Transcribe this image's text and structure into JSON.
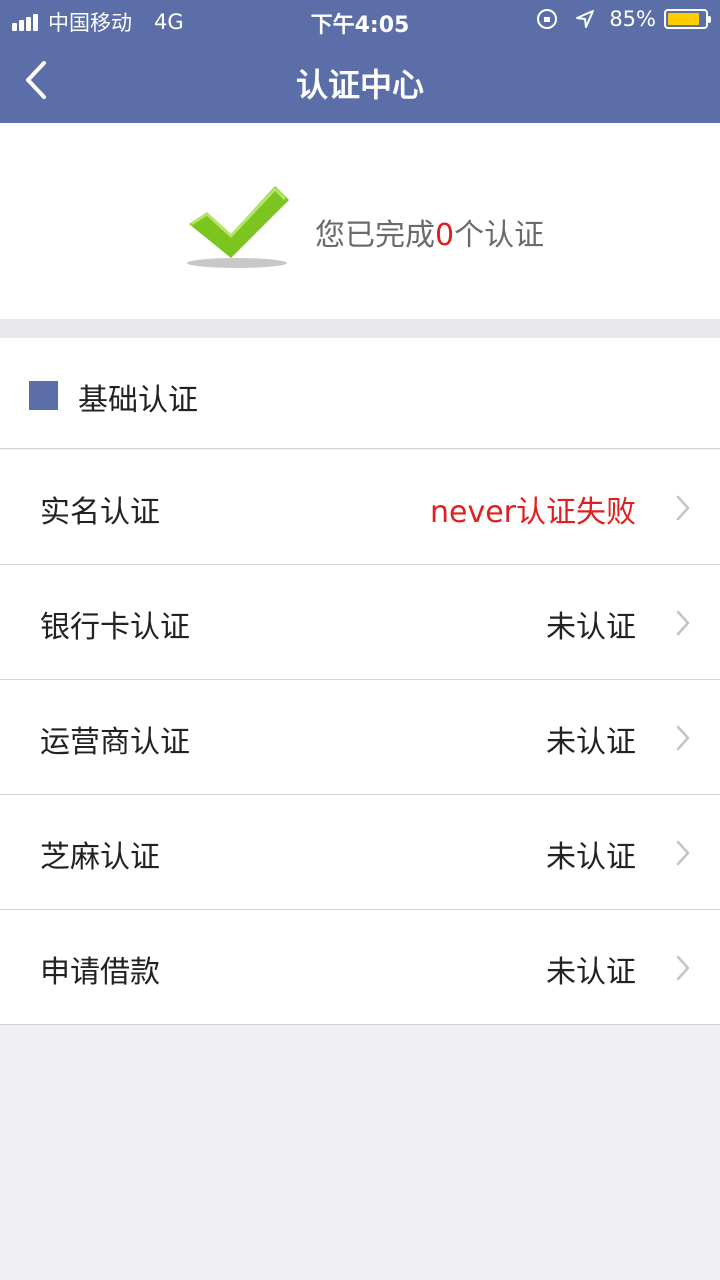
{
  "status_bar": {
    "carrier": "中国移动",
    "network": "4G",
    "time": "下午4:05",
    "battery": "85%"
  },
  "nav": {
    "title": "认证中心"
  },
  "summary": {
    "prefix": "您已完成",
    "count": "0",
    "suffix": "个认证"
  },
  "section": {
    "title": "基础认证"
  },
  "items": [
    {
      "label": "实名认证",
      "status": "never认证失败",
      "state": "fail"
    },
    {
      "label": "银行卡认证",
      "status": "未认证",
      "state": "none"
    },
    {
      "label": "运营商认证",
      "status": "未认证",
      "state": "none"
    },
    {
      "label": "芝麻认证",
      "status": "未认证",
      "state": "none"
    },
    {
      "label": "申请借款",
      "status": "未认证",
      "state": "none"
    }
  ],
  "colors": {
    "primary": "#5b6ea8",
    "fail": "#e02020",
    "check_green": "#7cc520"
  }
}
